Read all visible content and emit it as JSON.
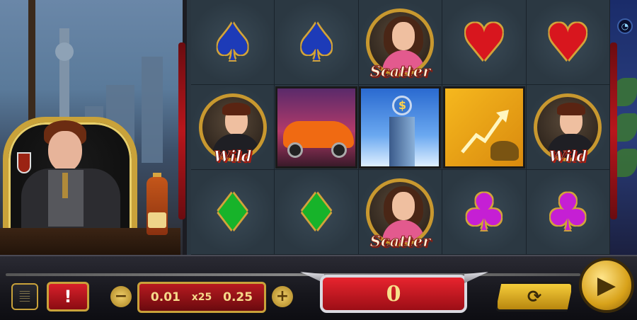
{
  "reels": {
    "rows": [
      [
        {
          "kind": "suit",
          "symbol": "spade",
          "glyph": "♠"
        },
        {
          "kind": "suit",
          "symbol": "spade",
          "glyph": "♠"
        },
        {
          "kind": "portrait",
          "symbol": "scatter",
          "label": "Scatter"
        },
        {
          "kind": "suit",
          "symbol": "heart",
          "glyph": "♥"
        },
        {
          "kind": "suit",
          "symbol": "heart",
          "glyph": "♥"
        }
      ],
      [
        {
          "kind": "portrait",
          "symbol": "wild",
          "label": "Wild"
        },
        {
          "kind": "picture",
          "symbol": "sports-car"
        },
        {
          "kind": "picture",
          "symbol": "bank-tower"
        },
        {
          "kind": "picture",
          "symbol": "bull-market"
        },
        {
          "kind": "portrait",
          "symbol": "wild",
          "label": "Wild"
        }
      ],
      [
        {
          "kind": "suit",
          "symbol": "diamond",
          "glyph": "♦"
        },
        {
          "kind": "suit",
          "symbol": "diamond",
          "glyph": "♦"
        },
        {
          "kind": "portrait",
          "symbol": "scatter",
          "label": "Scatter"
        },
        {
          "kind": "suit",
          "symbol": "club",
          "glyph": "♣"
        },
        {
          "kind": "suit",
          "symbol": "club",
          "glyph": "♣"
        }
      ]
    ]
  },
  "controls": {
    "menu_icon": "piano-keys-icon",
    "info_label": "!",
    "minus_label": "−",
    "plus_label": "+",
    "bet": {
      "coin": "0.01",
      "multiplier": "x25",
      "total": "0.25"
    },
    "win_value": "0",
    "auto_icon": "refresh-icon",
    "spin_icon": "play-icon"
  },
  "colors": {
    "spade": "#1d3bb8",
    "heart": "#d8161e",
    "diamond": "#17b32a",
    "club": "#c51fd4",
    "gold_trim": "#c9a23a",
    "red_panel": "#b81a20"
  }
}
